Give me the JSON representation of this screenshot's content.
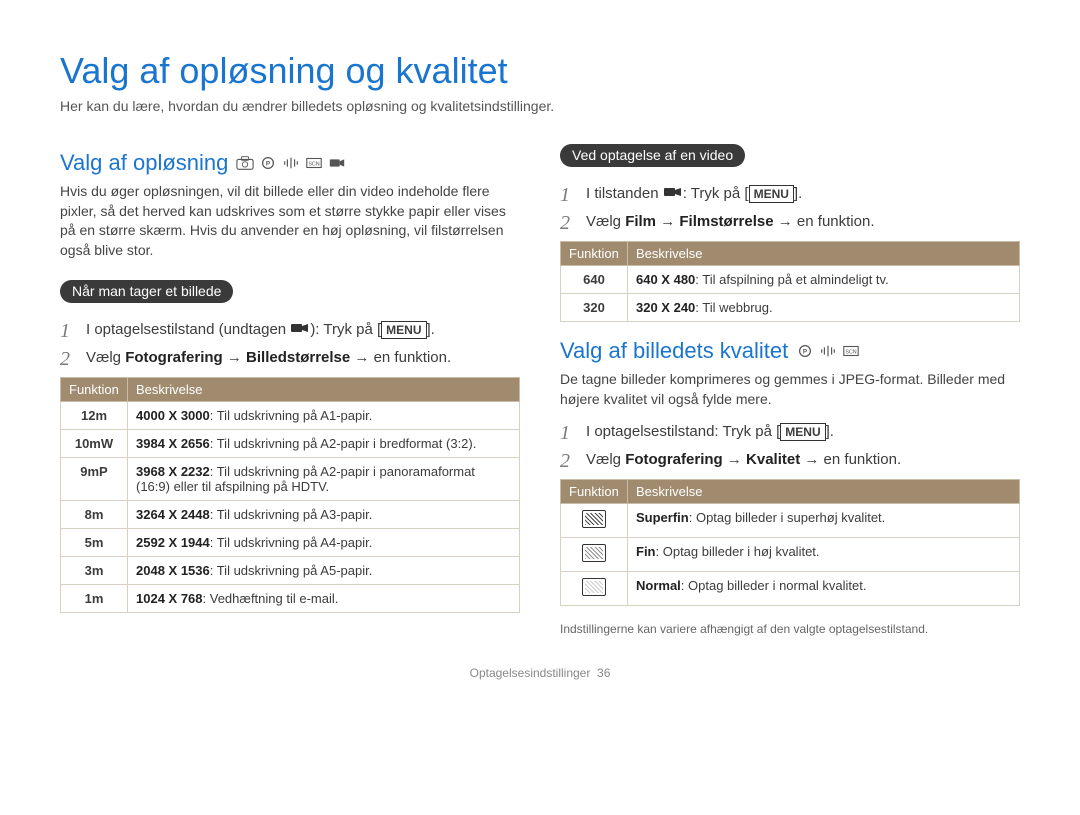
{
  "title": "Valg af opløsning og kvalitet",
  "intro": "Her kan du lære, hvordan du ændrer billedets opløsning og kvalitetsindstillinger.",
  "left": {
    "heading": "Valg af opløsning",
    "para": "Hvis du øger opløsningen, vil dit billede eller din video indeholde flere pixler, så det herved kan udskrives som et større stykke papir eller vises på en større skærm. Hvis du anvender en høj opløsning, vil filstørrelsen også blive stor.",
    "pill": "Når man tager et billede",
    "step1_a": "I optagelsestilstand (undtagen ",
    "step1_b": "): Tryk på [",
    "step1_c": "].",
    "menu": "MENU",
    "step2_a": "Vælg ",
    "step2_b": "Fotografering",
    "step2_c": " → ",
    "step2_d": "Billedstørrelse",
    "step2_e": " → en funktion.",
    "th_func": "Funktion",
    "th_desc": "Beskrivelse",
    "rows": [
      {
        "icon": "12m",
        "res": "4000 X 3000",
        "desc": ": Til udskrivning på A1-papir."
      },
      {
        "icon": "10mW",
        "res": "3984 X 2656",
        "desc": ": Til udskrivning på A2-papir i bredformat (3:2)."
      },
      {
        "icon": "9mP",
        "res": "3968 X 2232",
        "desc": ": Til udskrivning på A2-papir i panoramaformat (16:9) eller til afspilning på HDTV."
      },
      {
        "icon": "8m",
        "res": "3264 X 2448",
        "desc": ": Til udskrivning på A3-papir."
      },
      {
        "icon": "5m",
        "res": "2592 X 1944",
        "desc": ": Til udskrivning på A4-papir."
      },
      {
        "icon": "3m",
        "res": "2048 X 1536",
        "desc": ": Til udskrivning på A5-papir."
      },
      {
        "icon": "1m",
        "res": "1024 X 768",
        "desc": ": Vedhæftning til e-mail."
      }
    ]
  },
  "right": {
    "pill": "Ved optagelse af en video",
    "step1_a": "I tilstanden ",
    "step1_b": ": Tryk på [",
    "step1_c": "].",
    "menu": "MENU",
    "step2_a": "Vælg ",
    "step2_b": "Film",
    "step2_c": " → ",
    "step2_d": "Filmstørrelse",
    "step2_e": " → en funktion.",
    "th_func": "Funktion",
    "th_desc": "Beskrivelse",
    "rows": [
      {
        "icon": "640",
        "res": "640 X 480",
        "desc": ": Til afspilning på et almindeligt tv."
      },
      {
        "icon": "320",
        "res": "320 X 240",
        "desc": ": Til webbrug."
      }
    ],
    "heading2": "Valg af billedets kvalitet",
    "para2": "De tagne billeder komprimeres og gemmes i JPEG-format. Billeder med højere kvalitet vil også fylde mere.",
    "q_step1_a": "I optagelsestilstand: Tryk på [",
    "q_step1_b": "].",
    "q_step2_a": "Vælg ",
    "q_step2_b": "Fotografering",
    "q_step2_c": " → ",
    "q_step2_d": "Kvalitet",
    "q_step2_e": " → en funktion.",
    "q_rows": [
      {
        "name": "Superfin",
        "desc": ": Optag billeder i superhøj kvalitet."
      },
      {
        "name": "Fin",
        "desc": ": Optag billeder i høj kvalitet."
      },
      {
        "name": "Normal",
        "desc": ": Optag billeder i normal kvalitet."
      }
    ],
    "footnote": "Indstillingerne kan variere afhængigt af den valgte optagelsestilstand."
  },
  "footer_a": "Optagelsesindstillinger",
  "footer_b": "36"
}
